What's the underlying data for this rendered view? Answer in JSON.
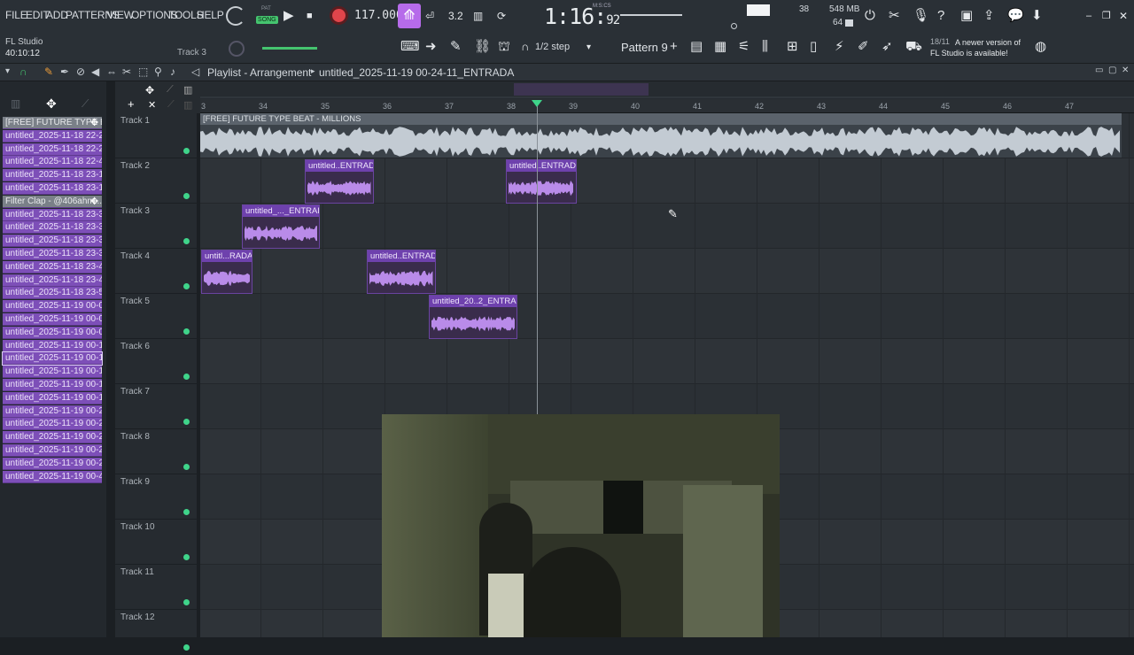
{
  "menu": [
    "FILE",
    "EDIT",
    "ADD",
    "PATTERNS",
    "VIEW",
    "OPTIONS",
    "TOOLS",
    "HELP"
  ],
  "transport": {
    "pat_label": "PAT",
    "song_label": "SONG",
    "tempo": "117.000",
    "time_main": "1:16",
    "time_sub": "92",
    "time_unit": "M:S:CS"
  },
  "meters": {
    "cpu_top": "38",
    "mem": "548 MB",
    "voices": "64"
  },
  "app": {
    "name": "FL Studio",
    "elapsed": "40:10:12",
    "track_label": "Track 3"
  },
  "toolbar2": {
    "step": "1/2 step",
    "pattern": "Pattern 9"
  },
  "notification": {
    "date": "18/11",
    "text": "A newer version of FL Studio is available!"
  },
  "playlist": {
    "title": "Playlist - Arrangement",
    "project": "untitled_2025-11-19 00-24-11_ENTRADA"
  },
  "browser_items": [
    {
      "label": "[FREE] FUTURE TYPE BE...",
      "kind": "gray"
    },
    {
      "label": "untitled_2025-11-18 22-24...",
      "kind": "purple"
    },
    {
      "label": "untitled_2025-11-18 22-27...",
      "kind": "purple"
    },
    {
      "label": "untitled_2025-11-18 22-45...",
      "kind": "purple"
    },
    {
      "label": "untitled_2025-11-18 23-10...",
      "kind": "purple"
    },
    {
      "label": "untitled_2025-11-18 23-11...",
      "kind": "purple"
    },
    {
      "label": "Filter Clap - @406ahm...",
      "kind": "gray"
    },
    {
      "label": "untitled_2025-11-18 23-35...",
      "kind": "purple"
    },
    {
      "label": "untitled_2025-11-18 23-36...",
      "kind": "purple"
    },
    {
      "label": "untitled_2025-11-18 23-37...",
      "kind": "purple"
    },
    {
      "label": "untitled_2025-11-18 23-39...",
      "kind": "purple"
    },
    {
      "label": "untitled_2025-11-18 23-46...",
      "kind": "purple"
    },
    {
      "label": "untitled_2025-11-18 23-48...",
      "kind": "purple"
    },
    {
      "label": "untitled_2025-11-18 23-51...",
      "kind": "purple"
    },
    {
      "label": "untitled_2025-11-19 00-01...",
      "kind": "purple"
    },
    {
      "label": "untitled_2025-11-19 00-05...",
      "kind": "purple"
    },
    {
      "label": "untitled_2025-11-19 00-07...",
      "kind": "purple"
    },
    {
      "label": "untitled_2025-11-19 00-16...",
      "kind": "purple"
    },
    {
      "label": "untitled_2025-11-19 00-16...",
      "kind": "purple-selected"
    },
    {
      "label": "untitled_2025-11-19 00-17...",
      "kind": "purple"
    },
    {
      "label": "untitled_2025-11-19 00-18...",
      "kind": "purple"
    },
    {
      "label": "untitled_2025-11-19 00-19...",
      "kind": "purple"
    },
    {
      "label": "untitled_2025-11-19 00-20...",
      "kind": "purple"
    },
    {
      "label": "untitled_2025-11-19 00-24...",
      "kind": "purple"
    },
    {
      "label": "untitled_2025-11-19 00-24...",
      "kind": "purple"
    },
    {
      "label": "untitled_2025-11-19 00-27...",
      "kind": "purple"
    },
    {
      "label": "untitled_2025-11-19 00-29...",
      "kind": "purple"
    },
    {
      "label": "untitled_2025-11-19 00-46...",
      "kind": "purple"
    }
  ],
  "tracks": [
    "Track 1",
    "Track 2",
    "Track 3",
    "Track 4",
    "Track 5",
    "Track 6",
    "Track 7",
    "Track 8",
    "Track 9",
    "Track 10",
    "Track 11",
    "Track 12"
  ],
  "ruler_bars": [
    "3",
    "34",
    "35",
    "36",
    "37",
    "38",
    "39",
    "40",
    "41",
    "42",
    "43",
    "44",
    "45",
    "46",
    "47"
  ],
  "clips": {
    "track1": "[FREE] FUTURE TYPE BEAT - MILLIONS",
    "t2a": "untitled..ENTRADA",
    "t2b": "untitled..ENTRADA",
    "t3a": "untitled_..._ENTRADA",
    "t4a": "untitl...RADA",
    "t4b": "untitled..ENTRADA",
    "t5a": "untitled_20..2_ENTRADA"
  },
  "colors": {
    "clip_purple": "#6e41ad",
    "wave_purple": "#b98be9",
    "accent_green": "#3fd48a",
    "record_red": "#e0454b"
  },
  "icons": [
    "record-icon",
    "play-icon",
    "stop-icon",
    "metronome-icon",
    "save-icon",
    "help-icon",
    "chat-icon",
    "download-icon",
    "mixer-icon",
    "piano-roll-icon",
    "magnet-icon",
    "pencil-icon",
    "zoom-icon"
  ]
}
